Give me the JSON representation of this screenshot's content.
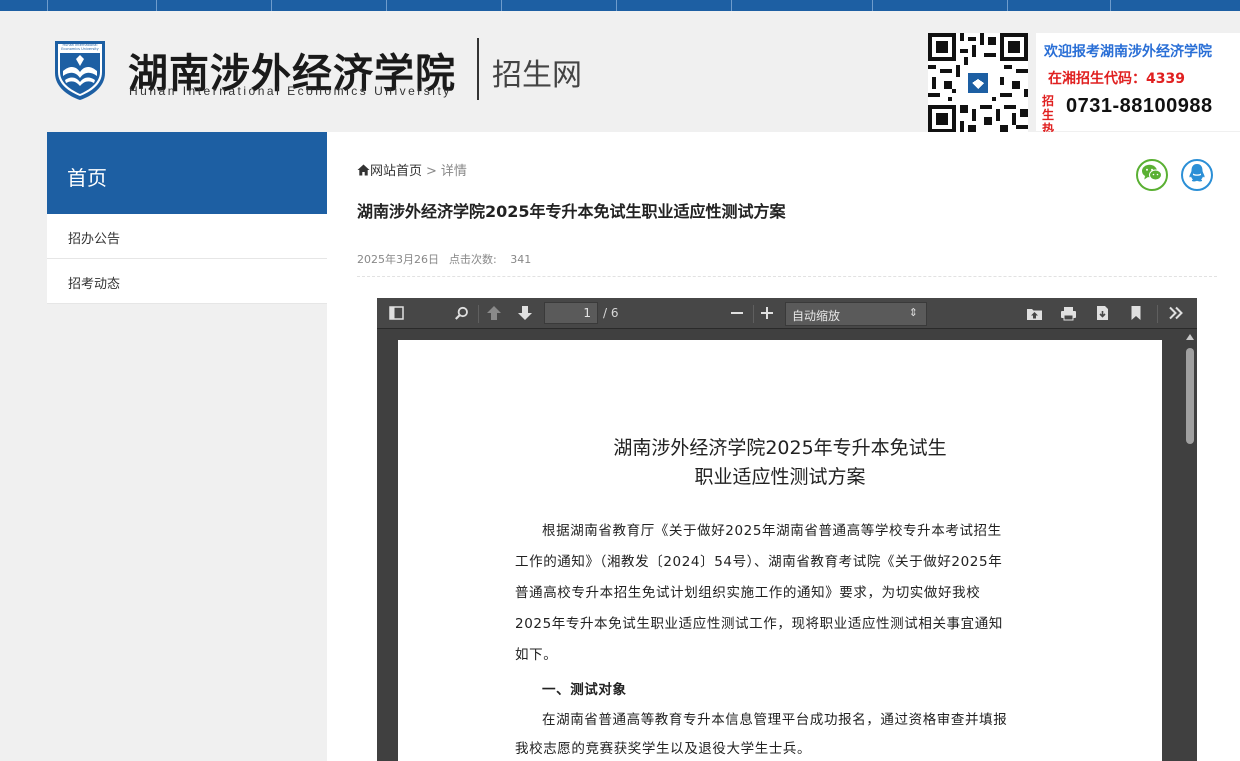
{
  "header": {
    "school_name_cn": "湖南涉外经济学院",
    "school_name_en": "Hunan International Economics University",
    "logo_text": "Hunan International Economics University",
    "site_name": "招生网",
    "promo": {
      "welcome": "欢迎报考湖南涉外经济学院",
      "code_label": "在湘招生代码：",
      "code_value": "4339",
      "hotline_label": "招生热线",
      "hotline": "0731-88100988"
    }
  },
  "sidebar": {
    "title": "首页",
    "items": [
      {
        "label": "招办公告"
      },
      {
        "label": "招考动态"
      }
    ]
  },
  "breadcrumb": {
    "home": "网站首页",
    "sep": ">",
    "current": "详情"
  },
  "article": {
    "title": "湖南涉外经济学院2025年专升本免试生职业适应性测试方案",
    "date": "2025年3月26日",
    "views_label": "点击次数:",
    "views": "341"
  },
  "viewer": {
    "page_current": "1",
    "page_total": "/ 6",
    "zoom": "自动缩放",
    "icons": [
      "sidebar-toggle-icon",
      "search-icon",
      "prev-page-icon",
      "next-page-icon",
      "zoom-out-icon",
      "zoom-in-icon",
      "open-file-icon",
      "print-icon",
      "download-icon",
      "bookmark-icon",
      "more-tools-icon"
    ]
  },
  "document": {
    "title_line1": "湖南涉外经济学院2025年专升本免试生",
    "title_line2": "职业适应性测试方案",
    "para1_lines": [
      "根据湖南省教育厅《关于做好2025年湖南省普通高等学校专升本考试招生",
      "工作的通知》（湘教发〔2024〕54号）、湖南省教育考试院《关于做好2025年",
      "普通高校专升本招生免试计划组织实施工作的通知》要求，为切实做好我校",
      "2025年专升本免试生职业适应性测试工作，现将职业适应性测试相关事宜通知",
      "如下。"
    ],
    "heading1": "一、测试对象",
    "para2_lines": [
      "在湖南省普通高等教育专升本信息管理平台成功报名，通过资格审查并填报",
      "我校志愿的竞赛获奖学生以及退役大学生士兵。"
    ]
  },
  "colors": {
    "brand_blue": "#1d5fa3",
    "wechat_green": "#5ab033",
    "qq_blue": "#2b8fd6"
  }
}
